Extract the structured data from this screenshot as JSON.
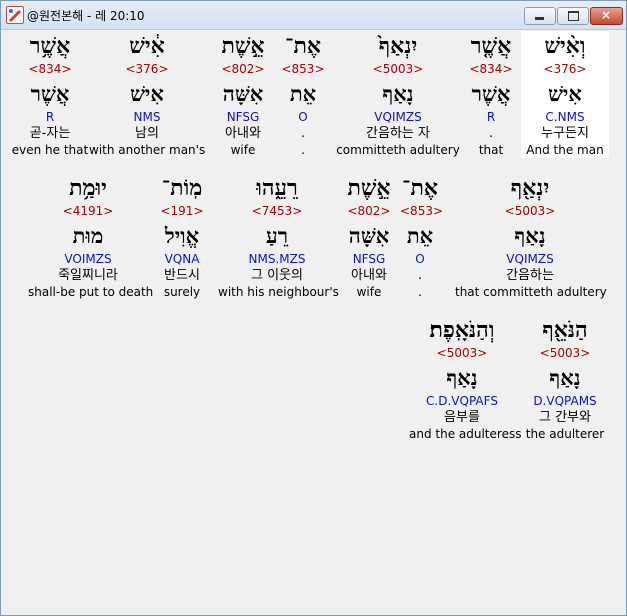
{
  "window": {
    "title": "@원전본해 - 레 20:10",
    "controls": {
      "minimize": "minimize",
      "maximize": "maximize",
      "close": "×"
    }
  },
  "rows": [
    [
      {
        "hebrew": "וְאִ֨ישׁ",
        "strong": "<376>",
        "lemma": "אִישׁ",
        "morph": "C.NMS",
        "korean": "누구든지",
        "english": "And the man",
        "highlight": true
      },
      {
        "hebrew": "אֲשֶׁ֤ר",
        "strong": "<834>",
        "lemma": "אֲשֶׁר",
        "morph": "R",
        "korean": ".",
        "english": "that",
        "highlight": false
      },
      {
        "hebrew": "יִנְאַף֙",
        "strong": "<5003>",
        "lemma": "נָאַף",
        "morph": "VQIMZS",
        "korean": "간음하는 자",
        "english": "committeth adultery",
        "highlight": false
      },
      {
        "hebrew": "אֶת־",
        "strong": "<853>",
        "lemma": "אֵת",
        "morph": "O",
        "korean": ".",
        "english": ".",
        "highlight": false
      },
      {
        "hebrew": "אֵ֣שֶׁת",
        "strong": "<802>",
        "lemma": "אִשָּׁה",
        "morph": "NFSG",
        "korean": "아내와",
        "english": "wife",
        "highlight": false
      },
      {
        "hebrew": "אִ֔ישׁ",
        "strong": "<376>",
        "lemma": "אִישׁ",
        "morph": "NMS",
        "korean": "남의",
        "english": "with another man's",
        "highlight": false
      },
      {
        "hebrew": "אֲשֶׁ֥ר",
        "strong": "<834>",
        "lemma": "אֲשֶׁר",
        "morph": "R",
        "korean": "곧-자는",
        "english": "even he that",
        "highlight": false
      }
    ],
    [
      {
        "hebrew": "יִנְאַ֖ף",
        "strong": "<5003>",
        "lemma": "נָאַף",
        "morph": "VQIMZS",
        "korean": "간음하는",
        "english": "that committeth adultery",
        "highlight": false
      },
      {
        "hebrew": "אֶת־",
        "strong": "<853>",
        "lemma": "אֵת",
        "morph": "O",
        "korean": ".",
        "english": ".",
        "highlight": false
      },
      {
        "hebrew": "אֵ֣שֶׁת",
        "strong": "<802>",
        "lemma": "אִשָּׁה",
        "morph": "NFSG",
        "korean": "아내와",
        "english": "wife",
        "highlight": false
      },
      {
        "hebrew": "רֵעֵ֑הוּ",
        "strong": "<7453>",
        "lemma": "רֵעַ",
        "morph": "NMS.MZS",
        "korean": "그 이웃의",
        "english": "with his neighbour's",
        "highlight": false
      },
      {
        "hebrew": "מֽוֹת־",
        "strong": "<191>",
        "lemma": "אֱוִיל",
        "morph": "VQNA",
        "korean": "반드시",
        "english": "surely",
        "highlight": false
      },
      {
        "hebrew": "יוּמַ֥ת",
        "strong": "<4191>",
        "lemma": "מוּת",
        "morph": "VOIMZS",
        "korean": "죽일찌니라",
        "english": "shall-be put to death",
        "highlight": false
      }
    ],
    [
      {
        "hebrew": "הַנֹּאֵ֖ף",
        "strong": "<5003>",
        "lemma": "נָאַף",
        "morph": "D.VQPAMS",
        "korean": "그 간부와",
        "english": "the adulterer",
        "highlight": false
      },
      {
        "hebrew": "וְהַנֹּאָֽפֶת׃",
        "strong": "<5003>",
        "lemma": "נָאַף",
        "morph": "C.D.VQPAFS",
        "korean": "음부를",
        "english": "and the adulteress",
        "highlight": false
      }
    ]
  ]
}
